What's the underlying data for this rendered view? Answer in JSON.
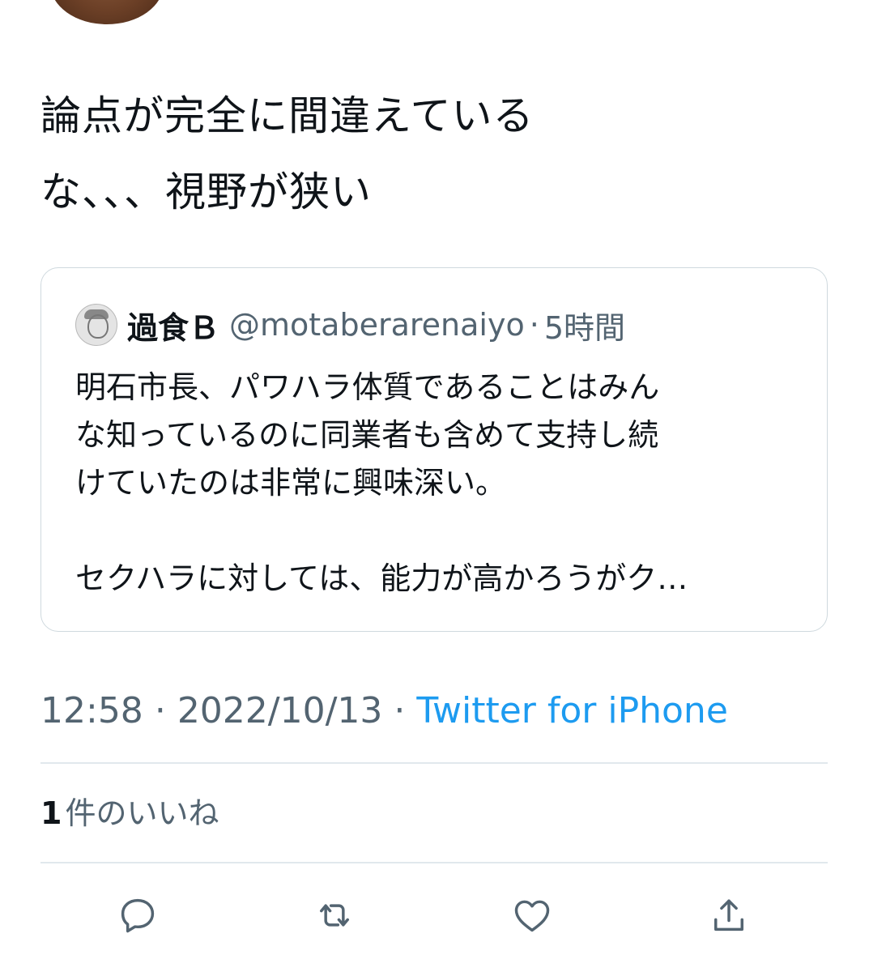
{
  "tweet": {
    "text_lines": [
      "論点が完全に間違えている",
      "な、、、視野が狭い"
    ]
  },
  "quote": {
    "name": "過食Ｂ",
    "handle": "@motaberarenaiyo",
    "separator": "·",
    "time": "5時間",
    "body_lines": [
      "明石市長、パワハラ体質であることはみん",
      "な知っているのに同業者も含めて支持し続",
      "けていたのは非常に興味深い。",
      "",
      "セクハラに対しては、能力が高かろうがク…"
    ]
  },
  "meta": {
    "time": "12:58",
    "sep1": "·",
    "date": "2022/10/13",
    "sep2": "·",
    "source": "Twitter for iPhone"
  },
  "likes": {
    "count": "1",
    "label": "件のいいね"
  },
  "actions": {
    "reply_icon": "reply-icon",
    "retweet_icon": "retweet-icon",
    "like_icon": "heart-icon",
    "share_icon": "share-icon"
  },
  "colors": {
    "text": "#0f1419",
    "secondary": "#536471",
    "link": "#1d9bf0",
    "border": "#cfd9de"
  }
}
